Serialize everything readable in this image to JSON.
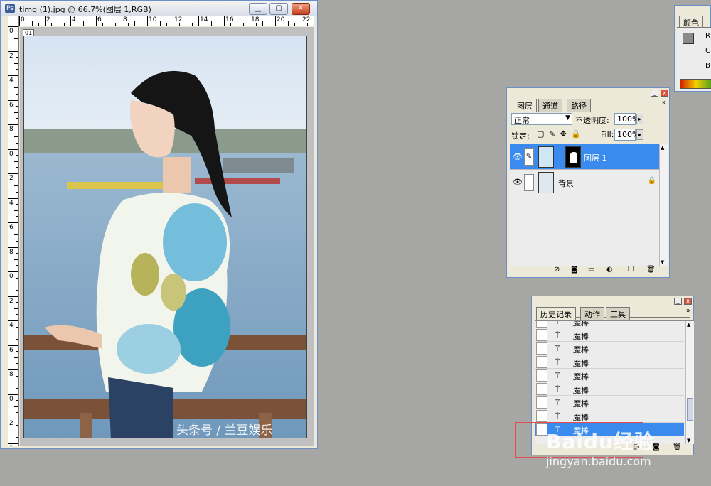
{
  "document": {
    "title": "timg (1).jpg @ 66.7%(图层 1,RGB)",
    "frame_indicator": "01",
    "ruler_h": [
      "0",
      "2",
      "4",
      "6",
      "8",
      "10",
      "12",
      "14",
      "16",
      "18",
      "20",
      "22"
    ],
    "ruler_v": [
      "0",
      "2",
      "4",
      "6",
      "8",
      "0",
      "2",
      "4",
      "6",
      "8",
      "0",
      "2",
      "4",
      "6",
      "8",
      "0",
      "2",
      "3"
    ],
    "watermark": "头条号 / 兰豆娱乐"
  },
  "color_panel": {
    "tab": "颜色",
    "labels": [
      "R",
      "G",
      "B"
    ]
  },
  "layers_panel": {
    "tabs": [
      "图层",
      "通道",
      "路径"
    ],
    "blend_mode": "正常",
    "opacity_label": "不透明度:",
    "opacity_value": "100%",
    "lock_label": "锁定:",
    "fill_label": "Fill:",
    "fill_value": "100%",
    "layers": [
      {
        "name": "图层 1",
        "selected": true
      },
      {
        "name": "背景",
        "selected": false
      }
    ]
  },
  "history_panel": {
    "tabs": [
      "历史记录",
      "动作",
      "工具"
    ],
    "items": [
      "魔棒",
      "魔棒",
      "魔棒",
      "魔棒",
      "魔棒",
      "魔棒",
      "魔棒",
      "魔棒",
      "魔棒"
    ]
  },
  "baidu": {
    "logo": "Baidu经验",
    "url": "jingyan.baidu.com"
  },
  "colors": {
    "selection": "#3b8bee",
    "canvas_bg": "#a6a6a4",
    "annotation": "#e64a4a"
  }
}
